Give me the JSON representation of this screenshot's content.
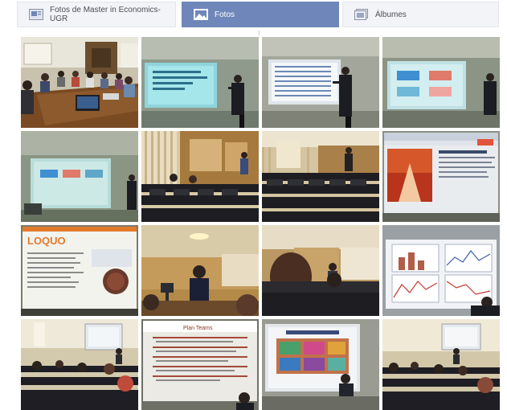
{
  "tabs": [
    {
      "label": "Fotos de Master in Economics-UGR",
      "icon": "page-icon",
      "active": false
    },
    {
      "label": "Fotos",
      "icon": "photos-icon",
      "active": true
    },
    {
      "label": "Álbumes",
      "icon": "albums-icon",
      "active": false
    }
  ],
  "photos": [
    {
      "scene": "meeting-room",
      "label": ""
    },
    {
      "scene": "presenter-slide-cyan",
      "label": ""
    },
    {
      "scene": "presenter-slide-table",
      "label": ""
    },
    {
      "scene": "presenter-slide-blocks",
      "label": ""
    },
    {
      "scene": "projector-blocks",
      "label": ""
    },
    {
      "scene": "auditorium-wood",
      "label": ""
    },
    {
      "scene": "auditorium-rows",
      "label": ""
    },
    {
      "scene": "screen-website-red",
      "label": ""
    },
    {
      "scene": "screen-website-logo",
      "label": "LOQUO"
    },
    {
      "scene": "speaker-dark",
      "label": ""
    },
    {
      "scene": "audience-back",
      "label": ""
    },
    {
      "scene": "screen-charts",
      "label": ""
    },
    {
      "scene": "classroom-left",
      "label": ""
    },
    {
      "scene": "slide-text",
      "label": "Plan Teams"
    },
    {
      "scene": "slide-presenter-color",
      "label": ""
    },
    {
      "scene": "classroom-right",
      "label": ""
    }
  ]
}
